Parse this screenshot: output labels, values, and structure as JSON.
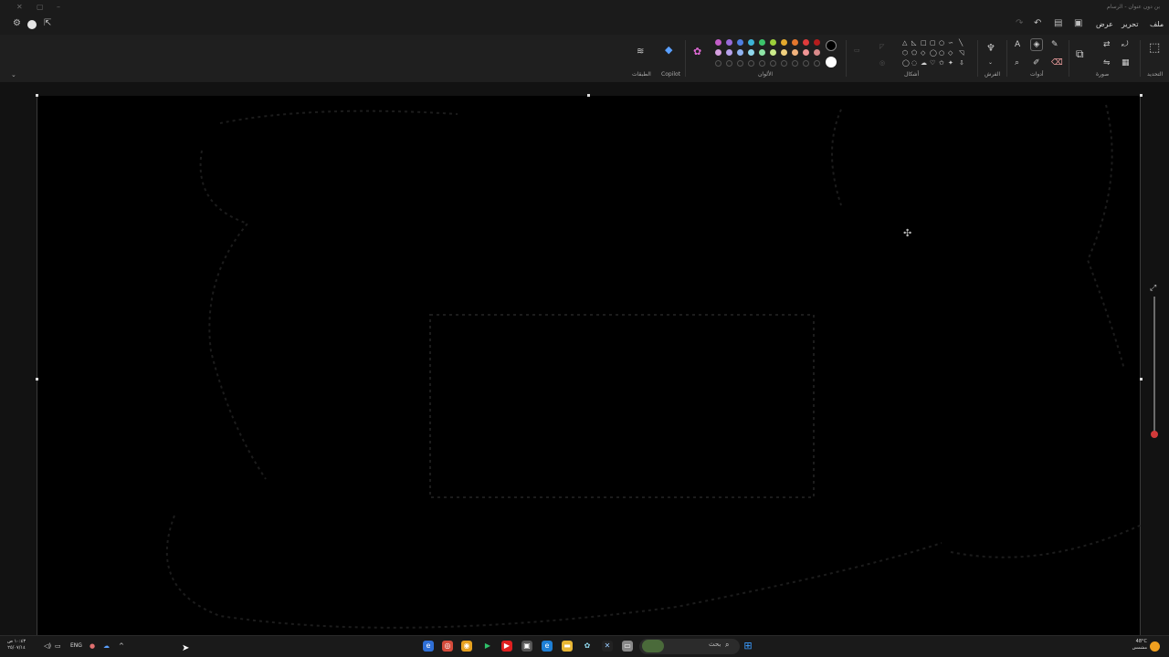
{
  "window": {
    "title": "بن دون عنوان - الرسام"
  },
  "menu": {
    "file": "ملف",
    "edit": "تحرير",
    "view": "عرض"
  },
  "ribbon": {
    "groups": {
      "select": "التحديد",
      "image": "صورة",
      "tools": "أدوات",
      "brushes": "الفرش",
      "shapes": "أشكال",
      "colors": "الألوان",
      "copilot": "Copilot",
      "layers": "الطبقات"
    }
  },
  "palette": {
    "row1": [
      "#c25dc7",
      "#9a6bd9",
      "#4f7fe0",
      "#3db3d6",
      "#3cc36b",
      "#9ccf3a",
      "#e2a92d",
      "#e2762d",
      "#de3b3b",
      "#b51d1d",
      "#6b6b6b",
      "#111111"
    ],
    "row2": [
      "#d7a0e0",
      "#b8a2ec",
      "#90b3f0",
      "#8fd7ec",
      "#8ee3a6",
      "#c9e98a",
      "#f0d07f",
      "#f1b27d",
      "#f09494",
      "#d98a8a",
      "#bdbdbd",
      "#ffffff"
    ],
    "primary": "#000000",
    "secondary": "#ffffff"
  },
  "taskbar": {
    "search": "بحث",
    "lang": "ENG",
    "clock_time": "١٠:٤٣ ص",
    "clock_date": "٢٥/٠٧/١٤",
    "weather_temp": "48°C",
    "weather_desc": "مشمس"
  }
}
